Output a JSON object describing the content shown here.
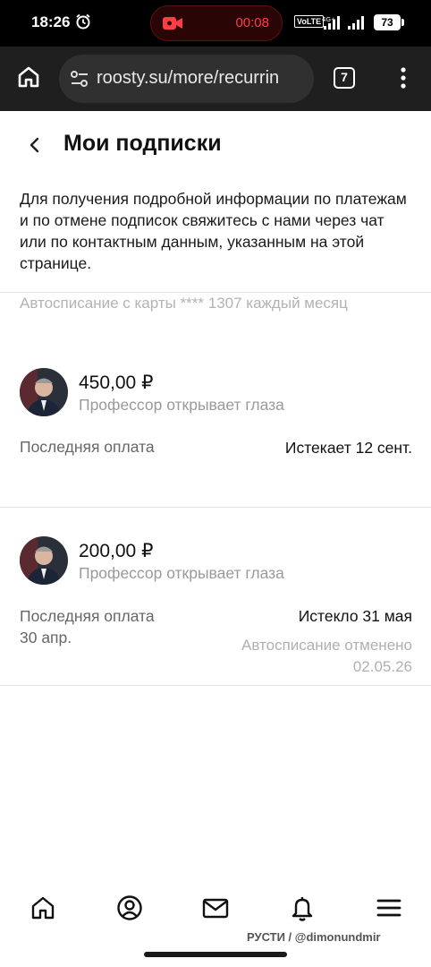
{
  "status_bar": {
    "time": "18:26",
    "recording_time": "00:08",
    "network_label": "VoLTE",
    "battery": "73",
    "accent_record": "#ff3d44"
  },
  "browser": {
    "url": "roosty.su/more/recurrin",
    "tab_count": "7"
  },
  "page": {
    "title": "Мои подписки",
    "info": "Для получения подробной информации по платежам и по отмене подписок свяжитесь с нами через чат или по контактным данным, указанным на этой странице.",
    "autopay_note": "Автосписание с карты **** 1307 каждый месяц"
  },
  "subscriptions": [
    {
      "price": "450,00 ₽",
      "product": "Профессор открывает глаза",
      "last_payment_label": "Последняя оплата",
      "last_payment_date": "",
      "expiry": "Истекает 12 сент."
    },
    {
      "price": "200,00 ₽",
      "product": "Профессор открывает глаза",
      "last_payment_label": "Последняя оплата",
      "last_payment_date": "30 апр.",
      "expiry": "Истекло 31 мая",
      "cancel_note": "Автосписание отменено",
      "cancel_date": "02.05.26"
    }
  ],
  "bottom_nav": {
    "icons": [
      "home-icon",
      "profile-icon",
      "mail-icon",
      "bell-icon",
      "menu-icon"
    ]
  },
  "watermark": "РУСТИ / @dimonundmir"
}
